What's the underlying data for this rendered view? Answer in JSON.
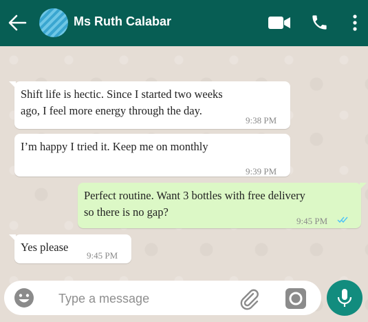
{
  "colors": {
    "header_bg": "#075e54",
    "incoming_bubble": "#ffffff",
    "outgoing_bubble": "#dcf8c6",
    "mic_button": "#128c7e",
    "read_ticks": "#4fc3f7"
  },
  "header": {
    "contact_name": "Ms Ruth Calabar",
    "icons": [
      "back-arrow-icon",
      "avatar",
      "video-call-icon",
      "phone-icon",
      "more-options-icon"
    ]
  },
  "messages": [
    {
      "direction": "in",
      "lines": [
        "Shift life is hectic. Since I started two weeks",
        "ago, I feel more energy through the day."
      ],
      "time": "9:38 PM"
    },
    {
      "direction": "in",
      "lines": [
        "I’m happy I tried it. Keep me on monthly"
      ],
      "time": "9:39 PM"
    },
    {
      "direction": "out",
      "lines": [
        "Perfect routine. Want 3 bottles with free delivery",
        "so there is no gap?"
      ],
      "time": "9:45 PM",
      "status": "read"
    },
    {
      "direction": "in",
      "lines": [
        "Yes please"
      ],
      "time": "9:45 PM"
    }
  ],
  "composer": {
    "placeholder": "Type a message",
    "icons": [
      "emoji-icon",
      "attach-icon",
      "camera-icon",
      "mic-icon"
    ]
  }
}
